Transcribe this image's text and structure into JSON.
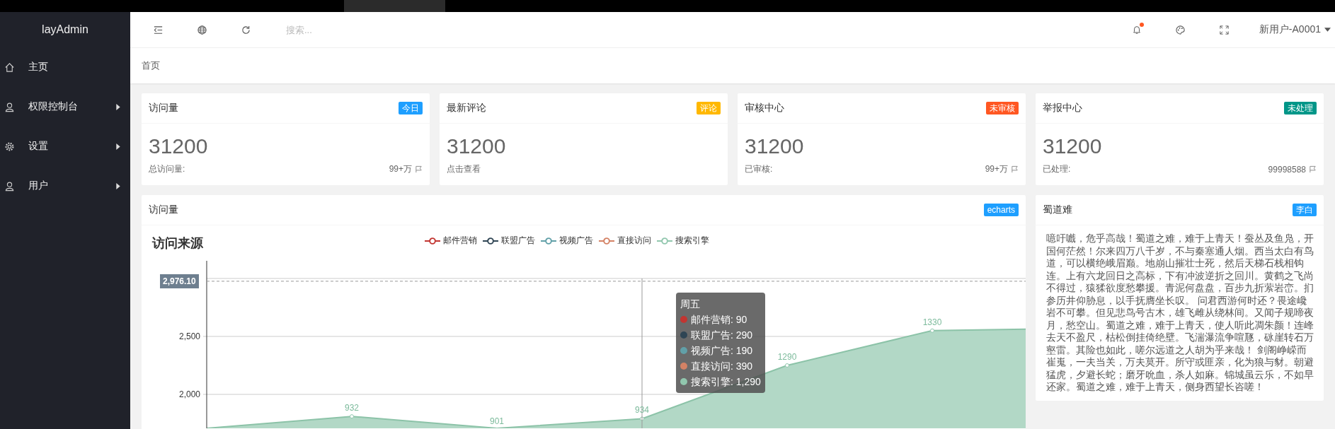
{
  "sidebar": {
    "logo": "layAdmin",
    "items": [
      {
        "label": "主页",
        "kind": "home",
        "has_children": false
      },
      {
        "label": "权限控制台",
        "kind": "user",
        "has_children": true
      },
      {
        "label": "设置",
        "kind": "gear",
        "has_children": true
      },
      {
        "label": "用户",
        "kind": "user",
        "has_children": true
      }
    ]
  },
  "header": {
    "search": {
      "placeholder": "搜索..."
    },
    "has_unread": true,
    "user": "新用户-A0001"
  },
  "breadcrumb": "首页",
  "stat_cards": [
    {
      "title": "访问量",
      "badge": "今日",
      "color": "#1e9fff",
      "value": "31200",
      "caption": "总访问量:",
      "extra": "99+万"
    },
    {
      "title": "最新评论",
      "badge": "评论",
      "color": "#ffb800",
      "value": "31200",
      "caption": "点击查看"
    },
    {
      "title": "审核中心",
      "badge": "未审核",
      "color": "#ff5722",
      "value": "31200",
      "caption": "已审核:",
      "extra": "99+万"
    },
    {
      "title": "举报中心",
      "badge": "未处理",
      "color": "#009688",
      "value": "31200",
      "caption": "已处理:",
      "extra": "99998588"
    }
  ],
  "chart_card": {
    "title": "访问量",
    "badge": "echarts",
    "color": "#1e9fff",
    "chart": {
      "title": "访问来源",
      "legend": [
        {
          "name": "邮件营销",
          "color": "#c23531"
        },
        {
          "name": "联盟广告",
          "color": "#2f4554"
        },
        {
          "name": "视频广告",
          "color": "#61a0a8"
        },
        {
          "name": "直接访问",
          "color": "#d48265"
        },
        {
          "name": "搜索引擎",
          "color": "#91c7ae"
        }
      ],
      "y_axis_labels": [
        "2,500",
        "2,000"
      ],
      "point_labels": [
        "932",
        "901",
        "934",
        "1290",
        "1330"
      ],
      "axis_pointer": "2,976.10"
    },
    "tooltip": {
      "title": "周五",
      "items": [
        {
          "label": "邮件营销: 90",
          "color": "#c23531"
        },
        {
          "label": "联盟广告: 290",
          "color": "#2f4554"
        },
        {
          "label": "视频广告: 190",
          "color": "#61a0a8"
        },
        {
          "label": "直接访问: 390",
          "color": "#d48265"
        },
        {
          "label": "搜索引擎: 1,290",
          "color": "#91c7ae"
        }
      ]
    }
  },
  "poem_card": {
    "title": "蜀道难",
    "badge": "李白",
    "color": "#1e9fff",
    "text": "噫吁嚱，危乎高哉！蜀道之难，难于上青天！蚕丛及鱼凫，开国何茫然！尔来四万八千岁，不与秦塞通人烟。西当太白有鸟道，可以横绝峨眉巅。地崩山摧壮士死，然后天梯石栈相钩连。上有六龙回日之高标，下有冲波逆折之回川。黄鹤之飞尚不得过，猿猱欲度愁攀援。青泥何盘盘，百步九折萦岩峦。扪参历井仰胁息，以手抚膺坐长叹。 问君西游何时还？畏途巉岩不可攀。但见悲鸟号古木，雄飞雌从绕林间。又闻子规啼夜月，愁空山。蜀道之难，难于上青天，使人听此凋朱颜！连峰去天不盈尺，枯松倒挂倚绝壁。飞湍瀑流争喧豗，砯崖转石万壑雷。其险也如此，嗟尔远道之人胡为乎来哉！ 剑阁峥嵘而崔嵬，一夫当关，万夫莫开。所守或匪亲，化为狼与豺。朝避猛虎，夕避长蛇；磨牙吮血，杀人如麻。锦城虽云乐，不如早还家。蜀道之难，难于上青天，侧身西望长咨嗟！"
  }
}
